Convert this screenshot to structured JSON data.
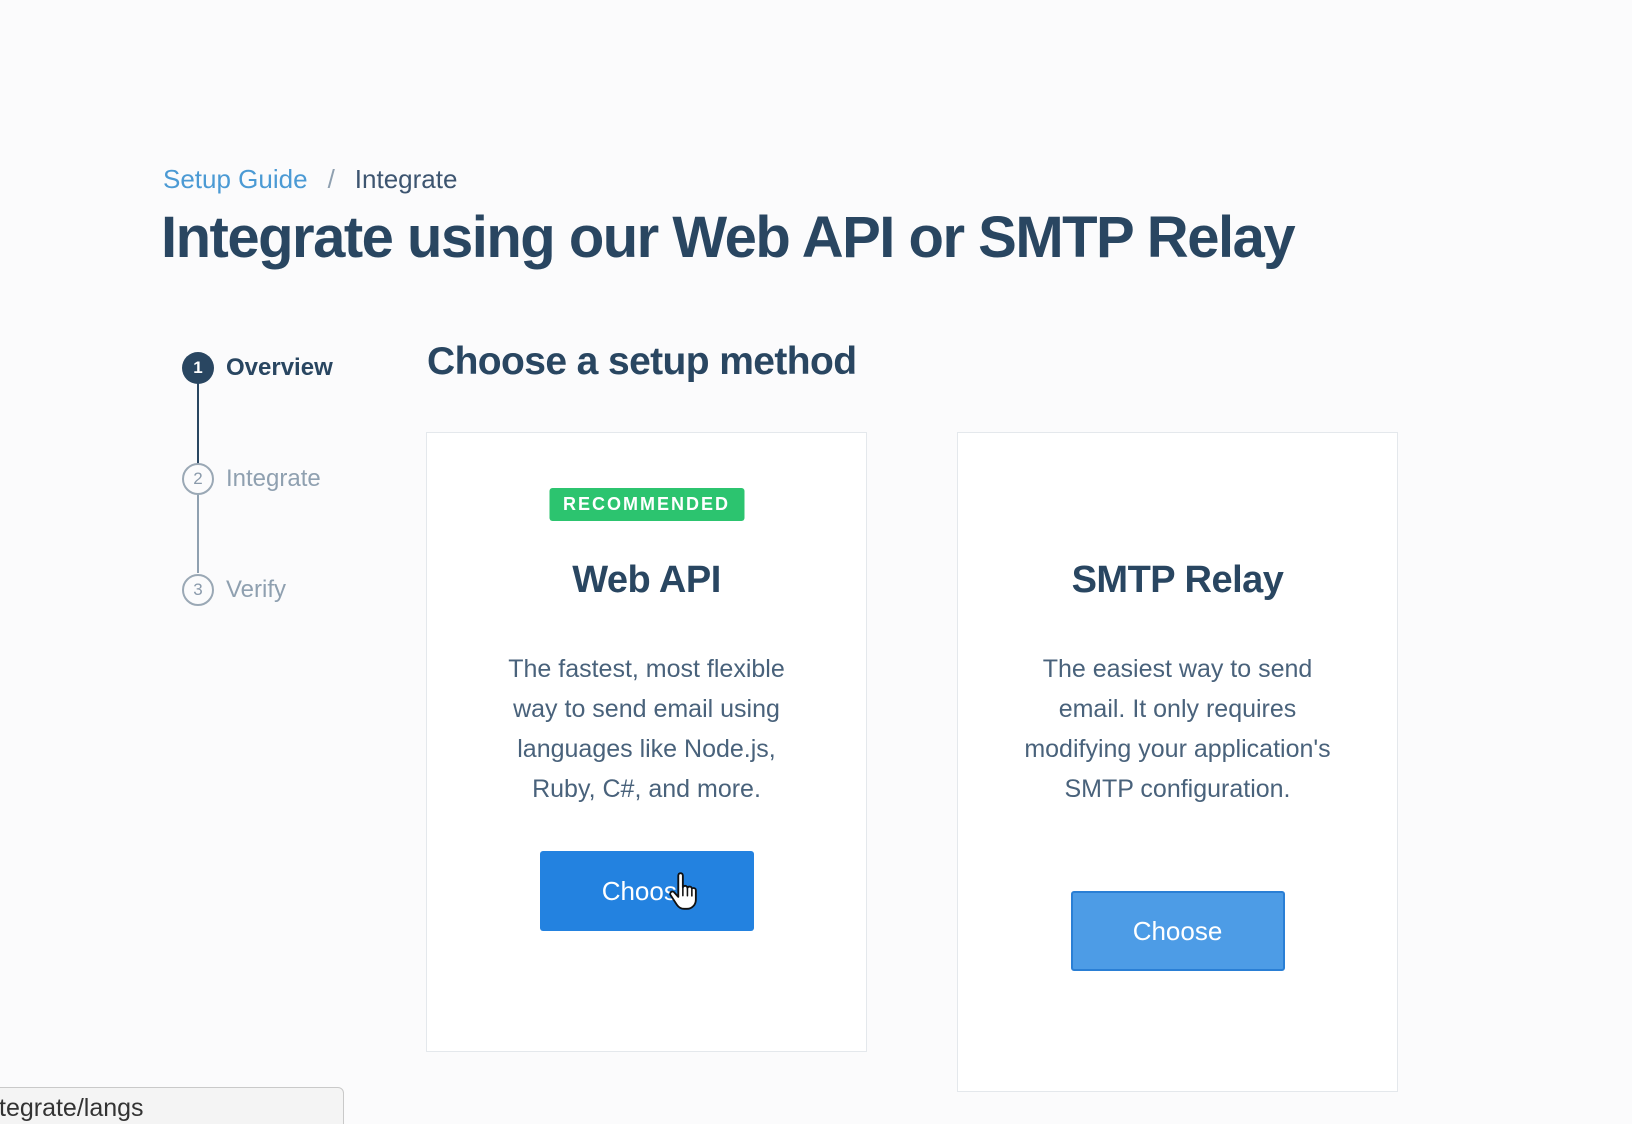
{
  "breadcrumb": {
    "link": "Setup Guide",
    "separator": "/",
    "current": "Integrate"
  },
  "page_title": "Integrate using our Web API or SMTP Relay",
  "stepper": {
    "steps": [
      {
        "number": "1",
        "label": "Overview",
        "state": "active"
      },
      {
        "number": "2",
        "label": "Integrate",
        "state": "inactive"
      },
      {
        "number": "3",
        "label": "Verify",
        "state": "inactive"
      }
    ]
  },
  "section_title": "Choose a setup method",
  "cards": {
    "web_api": {
      "badge": "RECOMMENDED",
      "title": "Web API",
      "description": "The fastest, most flexible way to send email using languages like Node.js, Ruby, C#, and more.",
      "button": "Choose"
    },
    "smtp": {
      "title": "SMTP Relay",
      "description": "The easiest way to send email. It only requires modifying your application's SMTP configuration.",
      "button": "Choose"
    }
  },
  "status_bar": {
    "url": "tegrate/langs"
  },
  "colors": {
    "primary_text": "#294661",
    "link": "#4b9ad4",
    "badge": "#2cc46f",
    "button": "#2382e0",
    "button_secondary": "#4d9ce6"
  },
  "icons": [
    "pointer-hand-icon"
  ]
}
